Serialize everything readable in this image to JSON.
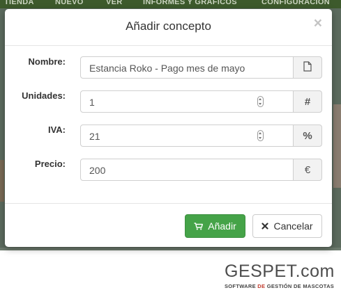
{
  "background_nav": {
    "items": [
      "TIENDA",
      "NUEVO",
      "VER",
      "INFORMES Y GRÁFICOS",
      "CONFIGURACIÓN"
    ]
  },
  "modal": {
    "title": "Añadir concepto",
    "close_label": "×",
    "fields": {
      "nombre": {
        "label": "Nombre:",
        "value": "Estancia Roko - Pago mes de mayo",
        "addon_icon": "document-icon"
      },
      "unidades": {
        "label": "Unidades:",
        "value": "1",
        "addon": "#"
      },
      "iva": {
        "label": "IVA:",
        "value": "21",
        "addon": "%"
      },
      "precio": {
        "label": "Precio:",
        "value": "200",
        "addon": "€"
      }
    },
    "buttons": {
      "add": {
        "label": "Añadir",
        "icon": "cart-icon"
      },
      "cancel": {
        "label": "Cancelar",
        "icon": "close-icon"
      }
    }
  },
  "logo": {
    "name": "GESPET.com",
    "tagline_pre": "SOFTWARE ",
    "tagline_accent": "DE",
    "tagline_post": " GESTIÓN DE MASCOTAS"
  },
  "colors": {
    "primary_green": "#45a348",
    "nav_green": "#3d5a2c",
    "overlay": "#5c6b5e",
    "logo_accent": "#c0392b"
  }
}
